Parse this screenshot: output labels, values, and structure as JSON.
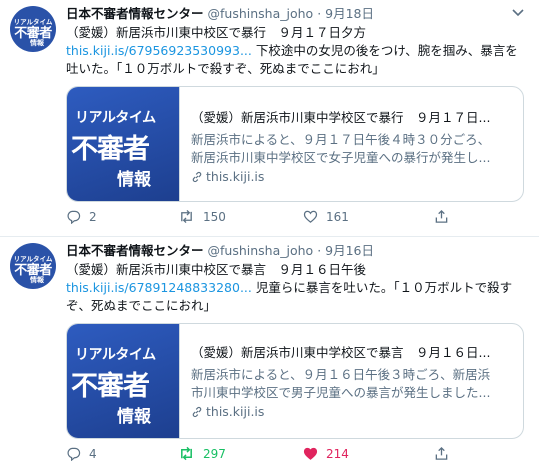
{
  "tweets": [
    {
      "avatar": {
        "line1": "リアルタイム",
        "line2": "不審者",
        "line3": "情報"
      },
      "name": "日本不審者情報センター",
      "handle": "@fushinsha_joho",
      "dot": "·",
      "date": "9月18日",
      "line1": "（愛媛）新居浜市川東中校区で暴行　９月１７日夕方",
      "link": "this.kiji.is/67956923530993...",
      "line2_rest": "下校途中の女児の後をつけ、腕を掴み、暴言を",
      "line3": "吐いた。「１０万ボルトで殺すぞ、死ぬまでここにおれ」",
      "card": {
        "img_line1": "リアルタイム",
        "img_line2": "不審者",
        "img_line3": "情報",
        "title": "（愛媛）新居浜市川東中学校区で暴行　９月１７日...",
        "desc_line1": "新居浜市によると、９月１７日午後４時３０分ごろ、",
        "desc_line2": "新居浜市川東中学校区で女子児童への暴行が発生し...",
        "domain": "this.kiji.is"
      },
      "reply_count": "2",
      "retweet_count": "150",
      "like_count": "161",
      "retweeted": false,
      "liked": false
    },
    {
      "avatar": {
        "line1": "リアルタイム",
        "line2": "不審者",
        "line3": "情報"
      },
      "name": "日本不審者情報センター",
      "handle": "@fushinsha_joho",
      "dot": "·",
      "date": "9月16日",
      "line1": "（愛媛）新居浜市川東中校区で暴言　９月１６日午後",
      "link": "this.kiji.is/67891248833280...",
      "line2_rest": "児童らに暴言を吐いた。「１０万ボルトで殺す",
      "line3": "ぞ、死ぬまでここにおれ」",
      "card": {
        "img_line1": "リアルタイム",
        "img_line2": "不審者",
        "img_line3": "情報",
        "title": "（愛媛）新居浜市川東中学校区で暴言　９月１６日...",
        "desc_line1": "新居浜市によると、９月１６日午後３時ごろ、新居浜",
        "desc_line2": "市川東中学校区で男子児童への暴言が発生しました...",
        "domain": "this.kiji.is"
      },
      "reply_count": "4",
      "retweet_count": "297",
      "like_count": "214",
      "retweeted": true,
      "liked": true
    }
  ],
  "colors": {
    "link": "#1b95e0",
    "muted": "#5b7083",
    "retweet_active": "#17bf63",
    "like_active": "#e0245e",
    "card_brand": "#2a52a8"
  }
}
